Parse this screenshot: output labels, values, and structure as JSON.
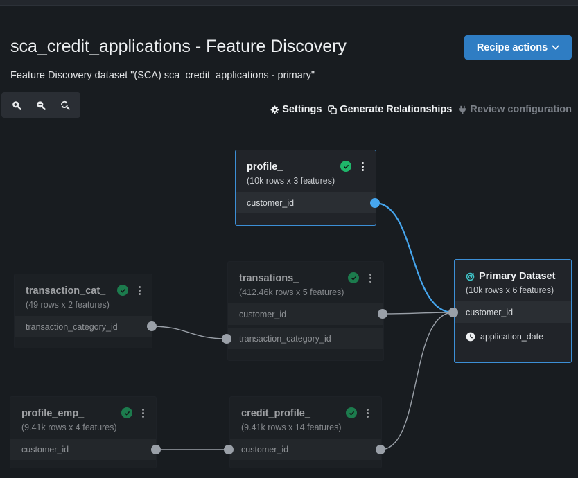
{
  "header": {
    "title": "sca_credit_applications - Feature Discovery",
    "subtitle": "Feature Discovery dataset \"(SCA) sca_credit_applications - primary\"",
    "recipe_actions_label": "Recipe actions"
  },
  "zoom_toolbar": {
    "zoom_in": "zoom-in-icon",
    "zoom_out": "zoom-out-icon",
    "reset": "reset-zoom-icon"
  },
  "actions": {
    "settings": "Settings",
    "generate_relationships": "Generate Relationships",
    "review_configuration": "Review configuration"
  },
  "colors": {
    "accent": "#2f7dc3",
    "active_edge": "#46a6ee",
    "success": "#1fb56a",
    "background": "#181c20"
  },
  "nodes": {
    "profile": {
      "title": "profile_",
      "subtitle": "(10k rows x 3 features)",
      "status": "success",
      "fields": [
        "customer_id"
      ]
    },
    "transaction_cat": {
      "title": "transaction_cat_",
      "subtitle": "(49 rows x 2 features)",
      "status": "success",
      "fields": [
        "transaction_category_id"
      ]
    },
    "transations": {
      "title": "transations_",
      "subtitle": "(412.46k rows x 5 features)",
      "status": "success",
      "fields": [
        "customer_id",
        "transaction_category_id"
      ]
    },
    "primary": {
      "title": "Primary Dataset",
      "subtitle": "(10k rows x 6 features)",
      "fields": [
        "customer_id",
        "application_date"
      ]
    },
    "profile_emp": {
      "title": "profile_emp_",
      "subtitle": "(9.41k rows x 4 features)",
      "status": "success",
      "fields": [
        "customer_id"
      ]
    },
    "credit_profile": {
      "title": "credit_profile_",
      "subtitle": "(9.41k rows x 14 features)",
      "status": "success",
      "fields": [
        "customer_id"
      ]
    }
  },
  "relationships": [
    {
      "from": "profile_.customer_id",
      "to": "Primary Dataset.customer_id",
      "highlighted": true
    },
    {
      "from": "transations_.customer_id",
      "to": "Primary Dataset.customer_id",
      "highlighted": false
    },
    {
      "from": "credit_profile_.customer_id",
      "to": "Primary Dataset.customer_id",
      "highlighted": false
    },
    {
      "from": "transaction_cat_.transaction_category_id",
      "to": "transations_.transaction_category_id",
      "highlighted": false
    },
    {
      "from": "profile_emp_.customer_id",
      "to": "credit_profile_.customer_id",
      "highlighted": false
    }
  ]
}
